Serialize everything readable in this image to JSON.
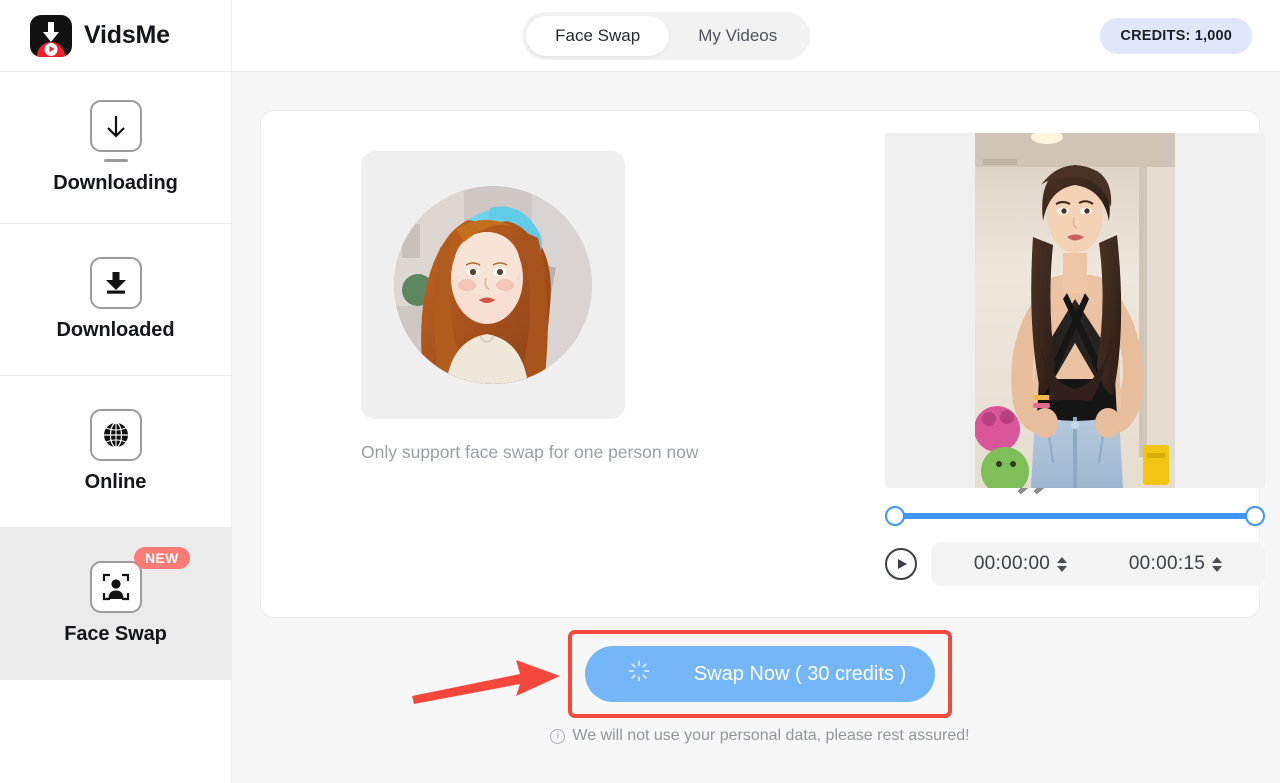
{
  "header": {
    "brand_name": "VidsMe",
    "logo_icon": "vidsme-download-play-logo",
    "tabs": [
      {
        "label": "Face Swap",
        "active": true
      },
      {
        "label": "My Videos",
        "active": false
      }
    ],
    "credits_label": "CREDITS: 1,000"
  },
  "sidebar": {
    "items": [
      {
        "label": "Downloading",
        "icon": "download-arrow-icon",
        "active": false,
        "badge": null
      },
      {
        "label": "Downloaded",
        "icon": "download-complete-icon",
        "active": false,
        "badge": null
      },
      {
        "label": "Online",
        "icon": "globe-icon",
        "active": false,
        "badge": null
      },
      {
        "label": "Face Swap",
        "icon": "face-detect-icon",
        "active": true,
        "badge": "NEW"
      }
    ]
  },
  "main": {
    "source": {
      "name": "source-face-thumbnail",
      "hint": "Only support face swap for one person now"
    },
    "transfer_icon": "double-chevron-right-icon",
    "target": {
      "name": "target-video-thumbnail",
      "slider": {
        "start_percent": 0,
        "end_percent": 100
      },
      "play_icon": "play-circle-icon",
      "start_time": "00:00:00",
      "end_time": "00:00:15"
    }
  },
  "footer": {
    "swap_button_label": "Swap Now ( 30 credits )",
    "swap_button_icon": "loading-spinner-icon",
    "disclaimer": "We will not use your personal data, please rest assured!",
    "disclaimer_icon": "info-circle-icon"
  },
  "annotations": {
    "highlight_color": "#f4483c",
    "arrow_icon": "red-pointer-arrow"
  },
  "colors": {
    "accent_blue": "#3e96f4",
    "button_blue": "#74b6f8",
    "credits_bg": "#dfe7fb",
    "badge_red": "#fa7b73",
    "annotation_red": "#f4483c",
    "page_bg": "#f7f7f7"
  }
}
